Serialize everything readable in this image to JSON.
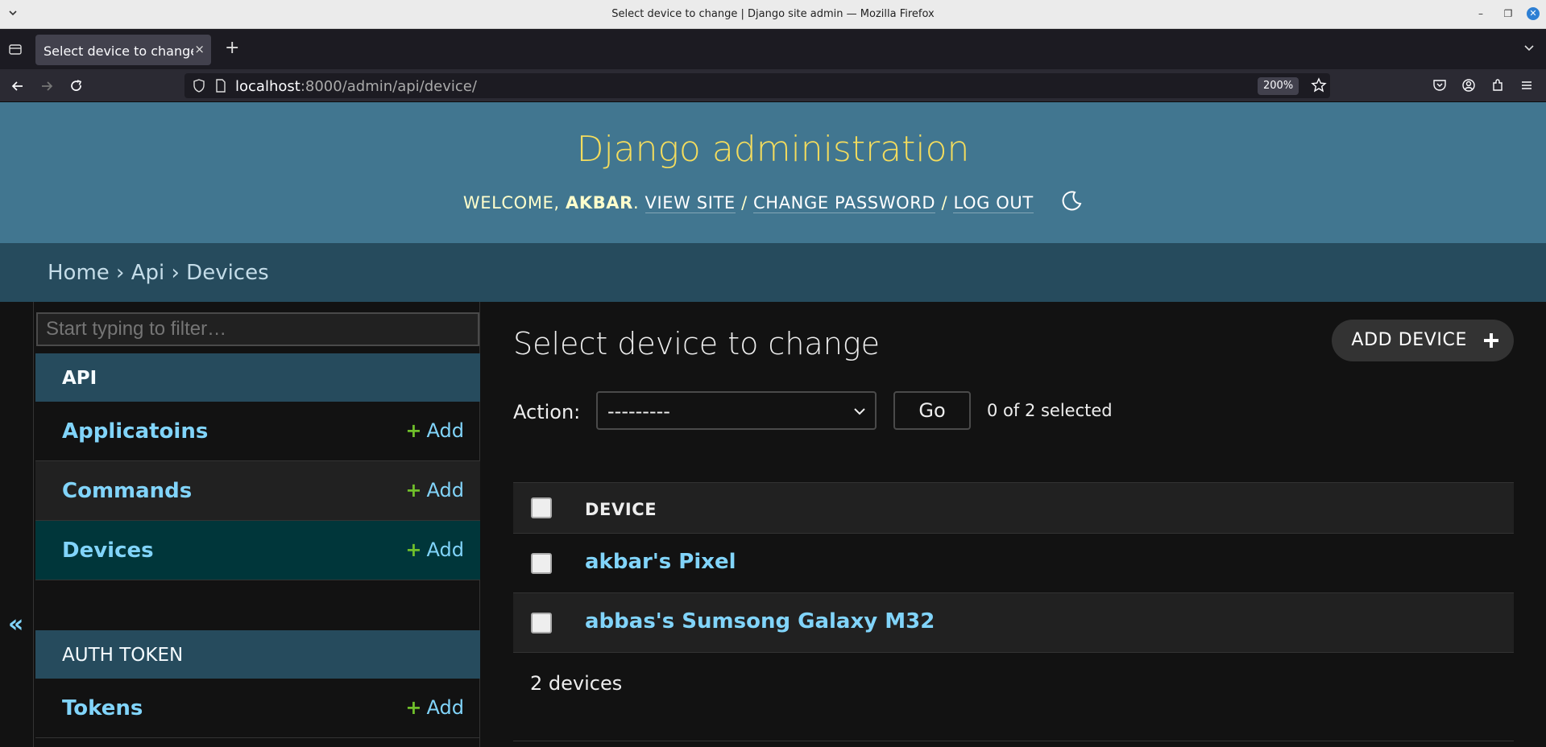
{
  "window": {
    "title": "Select device to change | Django site admin — Mozilla Firefox",
    "tab_title": "Select device to change | Django site admin",
    "tab_close": "×",
    "new_tab": "+",
    "url_host": "localhost",
    "url_rest": ":8000/admin/api/device/",
    "zoom": "200%"
  },
  "header": {
    "branding": "Django administration",
    "welcome": "WELCOME,",
    "username": "AKBAR",
    "view_site": "VIEW SITE",
    "change_password": "CHANGE PASSWORD",
    "log_out": "LOG OUT",
    "separator": "/"
  },
  "breadcrumbs": {
    "home": "Home",
    "app": "Api",
    "current": "Devices",
    "sep": "›"
  },
  "sidebar": {
    "toggle": "«",
    "filter_placeholder": "Start typing to filter…",
    "add_label": "Add",
    "add_plus": "+",
    "apps": [
      {
        "caption": "API",
        "models": [
          "Applicatoins",
          "Commands",
          "Devices"
        ]
      },
      {
        "caption": "AUTH TOKEN",
        "models": [
          "Tokens"
        ]
      }
    ]
  },
  "content": {
    "title": "Select device to change",
    "add_button": "ADD DEVICE",
    "action_label": "Action:",
    "action_selected": "---------",
    "go_button": "Go",
    "selected_count": "0 of 2 selected",
    "column_header": "DEVICE",
    "rows": [
      "akbar's Pixel",
      "abbas's Sumsong Galaxy M32"
    ],
    "result_count": "2 devices"
  },
  "colors": {
    "header_bg": "#417690",
    "branding": "#f5dd5d",
    "breadcrumbs_bg": "#264b5d",
    "link": "#81d4fa",
    "add_plus": "#70bf2b",
    "selected_row_bg": "#00363a"
  }
}
